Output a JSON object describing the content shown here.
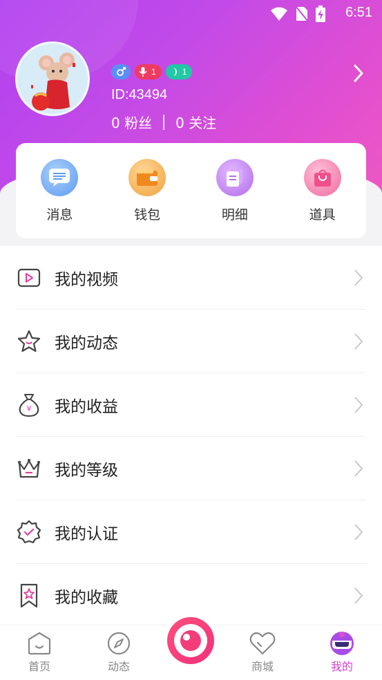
{
  "status_bar": {
    "time": "6:51"
  },
  "profile": {
    "user_id": "ID:43494",
    "fans_count": "0",
    "fans_label": "粉丝",
    "following_count": "0",
    "following_label": "关注",
    "badges": {
      "voice_level": "1",
      "vip_level": "1"
    }
  },
  "quick_actions": [
    {
      "label": "消息",
      "icon": "message-icon",
      "color": "#6aa6f2"
    },
    {
      "label": "钱包",
      "icon": "wallet-icon",
      "color": "#f3a23d"
    },
    {
      "label": "明细",
      "icon": "details-icon",
      "color": "#b56cf0"
    },
    {
      "label": "道具",
      "icon": "props-bag-icon",
      "color": "#f06aa0"
    }
  ],
  "menu": [
    {
      "label": "我的视频",
      "icon": "video-icon"
    },
    {
      "label": "我的动态",
      "icon": "star-icon"
    },
    {
      "label": "我的收益",
      "icon": "money-bag-icon"
    },
    {
      "label": "我的等级",
      "icon": "crown-icon"
    },
    {
      "label": "我的认证",
      "icon": "certified-badge-icon"
    },
    {
      "label": "我的收藏",
      "icon": "bookmark-star-icon"
    }
  ],
  "tabbar": [
    {
      "label": "首页",
      "icon": "home-icon",
      "active": false
    },
    {
      "label": "动态",
      "icon": "compass-icon",
      "active": false
    },
    {
      "label": "商城",
      "icon": "heart-icon",
      "active": false
    },
    {
      "label": "我的",
      "icon": "mine-icon",
      "active": true
    }
  ],
  "colors": {
    "accent": "#d83fd2",
    "header_start": "#b040f0",
    "header_end": "#f25bbd"
  }
}
